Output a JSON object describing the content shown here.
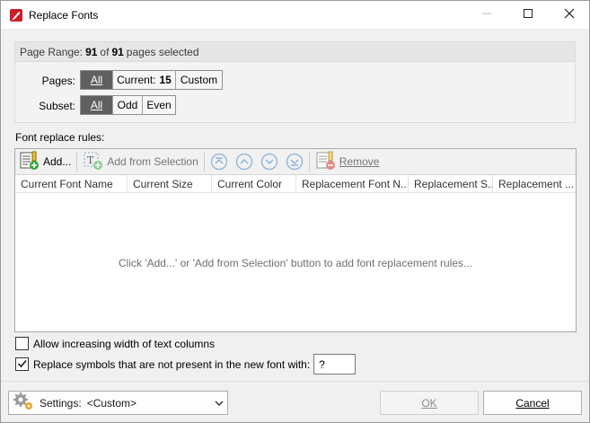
{
  "window": {
    "title": "Replace Fonts",
    "icons": {
      "app": "pdf-app-icon",
      "minimize": "minimize-icon",
      "maximize": "maximize-icon",
      "close": "close-icon"
    }
  },
  "page_range": {
    "prefix": "Page Range:",
    "selected": "91",
    "of_label": "of",
    "total": "91",
    "suffix": "pages selected",
    "pages_label": "Pages:",
    "pages_options": {
      "all": "All",
      "current_label": "Current:",
      "current_value": "15",
      "custom": "Custom"
    },
    "pages_selected": "All",
    "subset_label": "Subset:",
    "subset_options": [
      "All",
      "Odd",
      "Even"
    ],
    "subset_selected": "All"
  },
  "rules": {
    "label": "Font replace rules:",
    "toolbar": {
      "add": "Add...",
      "add_from_selection": "Add from Selection",
      "remove": "Remove",
      "icons": [
        "add-icon",
        "add-from-selection-icon",
        "move-top-icon",
        "move-up-icon",
        "move-down-icon",
        "move-bottom-icon",
        "remove-icon"
      ]
    },
    "columns": [
      "Current Font Name",
      "Current Size",
      "Current Color",
      "Replacement Font N...",
      "Replacement S...",
      "Replacement ..."
    ],
    "empty_message": "Click 'Add...' or 'Add from Selection' button to add font replacement rules..."
  },
  "options": {
    "allow_width": {
      "label": "Allow increasing width of text columns",
      "checked": false
    },
    "replace_symbols": {
      "label": "Replace symbols that are not present in the new font with:",
      "checked": true,
      "value": "?"
    }
  },
  "footer": {
    "settings_label": "Settings:",
    "settings_value": "<Custom>",
    "ok": "OK",
    "cancel": "Cancel"
  },
  "colors": {
    "segment_active": "#5f5f5f",
    "accent": "#1e6fd0"
  }
}
